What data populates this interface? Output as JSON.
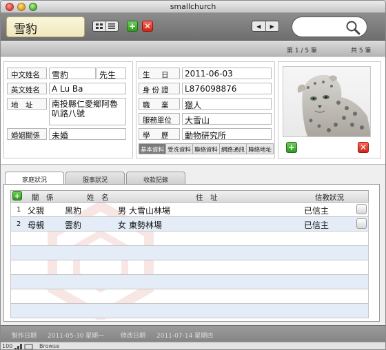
{
  "window": {
    "title": "smallchurch"
  },
  "toolbar": {
    "name_display": "雪豹",
    "grid_view_icon": "grid-icon",
    "list_view_icon": "list-icon",
    "add_glyph": "+",
    "delete_glyph": "✕",
    "prev_glyph": "◀",
    "next_glyph": "▶",
    "search_icon": "magnifier-icon"
  },
  "record_bar": {
    "position": "第 1 / 5 筆",
    "total": "共 5 筆"
  },
  "form": {
    "chinese_name_label": "中文姓名",
    "chinese_name": "雪豹",
    "title": "先生",
    "english_name_label": "英文姓名",
    "english_name": "A Lu Ba",
    "address_label": "地　址",
    "address": "南投縣仁愛鄉阿魯叭路八號",
    "marital_label": "婚姻關係",
    "marital": "未婚",
    "birthday_label": "生　日",
    "birthday": "2011-06-03",
    "id_label": "身份證",
    "id": "L876098876",
    "occupation_label": "職　業",
    "occupation": "獵人",
    "workplace_label": "服務單位",
    "workplace": "大雪山",
    "education_label": "學　歷",
    "education": "動物研究所"
  },
  "form_tabs": [
    "基本資料",
    "受洗資料",
    "聯絡資料",
    "網路通訊",
    "聯絡地址"
  ],
  "photo": {
    "add_glyph": "+",
    "delete_glyph": "✕"
  },
  "tabs": [
    "家庭狀況",
    "服事狀況",
    "收款記錄"
  ],
  "table": {
    "headers": {
      "relation": "關　係",
      "name": "姓　名",
      "address": "住　址",
      "faith": "信教狀況"
    },
    "add_glyph": "+",
    "rows": [
      {
        "no": "1",
        "relation": "父親",
        "name": "黑豹",
        "gender": "男",
        "address": "大雪山林場",
        "faith": "已信主"
      },
      {
        "no": "2",
        "relation": "母親",
        "name": "雲豹",
        "gender": "女",
        "address": "東勢林場",
        "faith": "已信主"
      }
    ]
  },
  "footer": {
    "created_label": "製作日期",
    "created": "2011-05-30 星期一",
    "modified_label": "修改日期",
    "modified": "2011-07-14 星期四"
  },
  "status": {
    "zoom": "100",
    "mode": "Browse"
  },
  "colors": {
    "accent_green": "#2e9a20",
    "accent_red": "#cf2414",
    "row_alt": "#e4ecf7"
  }
}
